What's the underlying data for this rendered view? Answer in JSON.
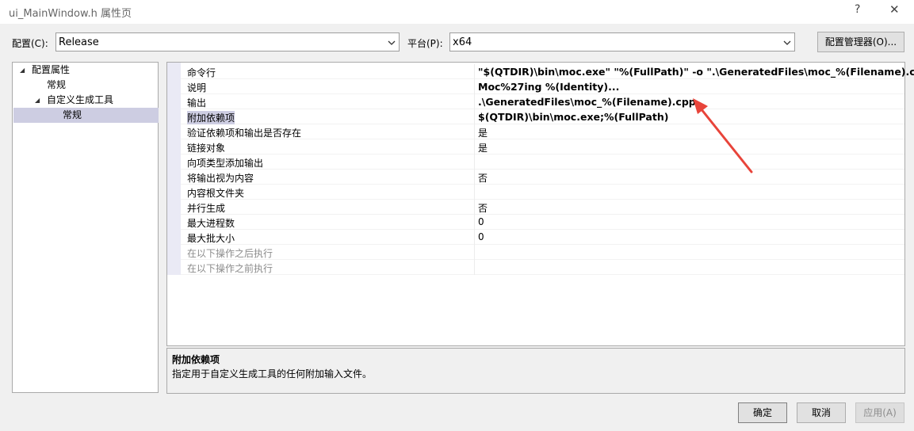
{
  "window": {
    "title": "ui_MainWindow.h 属性页",
    "help": "?",
    "close": "✕"
  },
  "toolbar": {
    "config_label": "配置(C):",
    "config_value": "Release",
    "platform_label": "平台(P):",
    "platform_value": "x64",
    "config_manager": "配置管理器(O)..."
  },
  "tree": {
    "items": [
      {
        "label": "配置属性"
      },
      {
        "label": "常规"
      },
      {
        "label": "自定义生成工具"
      },
      {
        "label": "常规"
      }
    ]
  },
  "properties": [
    {
      "name": "命令行",
      "value": "\"$(QTDIR)\\bin\\moc.exe\"  \"%(FullPath)\" -o \".\\GeneratedFiles\\moc_%(Filename).cpp\""
    },
    {
      "name": "说明",
      "value": "Moc%27ing %(Identity)..."
    },
    {
      "name": "输出",
      "value": ".\\GeneratedFiles\\moc_%(Filename).cpp"
    },
    {
      "name": "附加依赖项",
      "value": "$(QTDIR)\\bin\\moc.exe;%(FullPath)"
    },
    {
      "name": "验证依赖项和输出是否存在",
      "value": "是"
    },
    {
      "name": "链接对象",
      "value": "是"
    },
    {
      "name": "向项类型添加输出",
      "value": ""
    },
    {
      "name": "将输出视为内容",
      "value": "否"
    },
    {
      "name": "内容根文件夹",
      "value": ""
    },
    {
      "name": "并行生成",
      "value": "否"
    },
    {
      "name": "最大进程数",
      "value": "0"
    },
    {
      "name": "最大批大小",
      "value": "0"
    },
    {
      "name": "在以下操作之后执行",
      "value": ""
    },
    {
      "name": "在以下操作之前执行",
      "value": ""
    }
  ],
  "description": {
    "title": "附加依赖项",
    "text": "指定用于自定义生成工具的任何附加输入文件。"
  },
  "buttons": {
    "ok": "确定",
    "cancel": "取消",
    "apply": "应用(A)"
  },
  "colors": {
    "selection": "#cdcde2",
    "annotation_arrow": "#e8443a"
  }
}
